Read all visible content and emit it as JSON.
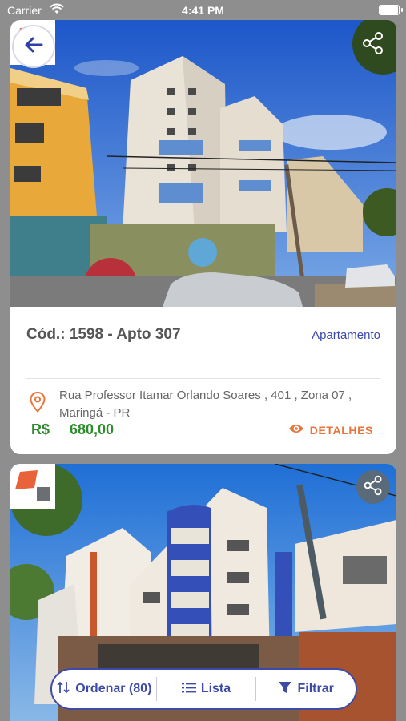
{
  "status_bar": {
    "carrier": "Carrier",
    "time": "4:41 PM"
  },
  "listing1": {
    "code": "Cód.: 1598 - Apto 307",
    "type": "Apartamento",
    "address": "Rua Professor Itamar Orlando Soares , 401 , Zona 07 , Maringá - PR",
    "currency": "R$",
    "price": "680,00",
    "details_label": "DETALHES"
  },
  "toolbar": {
    "order_label": "Ordenar (80)",
    "list_label": "Lista",
    "filter_label": "Filtrar"
  },
  "colors": {
    "accent": "#3d4aa8",
    "price": "#2e8b2e",
    "details": "#e8763b",
    "logo_orange": "#e8633a",
    "logo_gray": "#6b6e73"
  },
  "icons": [
    "back-arrow-icon",
    "share-icon",
    "location-pin-icon",
    "eye-icon",
    "sort-icon",
    "list-icon",
    "filter-icon",
    "wifi-icon",
    "battery-icon"
  ]
}
